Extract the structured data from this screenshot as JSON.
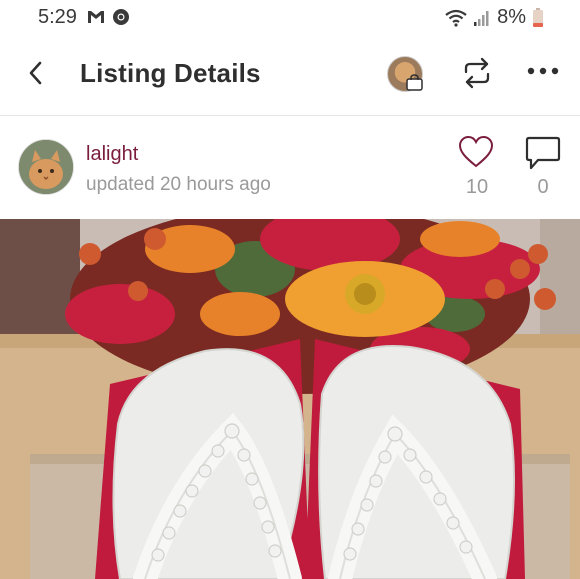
{
  "status_bar": {
    "time": "5:29",
    "battery": "8%",
    "icons": [
      "gmail-icon",
      "chrome-icon",
      "wifi-icon",
      "signal-icon",
      "battery-icon"
    ]
  },
  "header": {
    "title": "Listing Details",
    "icons": [
      "back-arrow-icon",
      "closet-avatar",
      "shopping-bag-icon",
      "share-icon",
      "more-icon"
    ]
  },
  "seller": {
    "username": "lalight",
    "updated": "updated 20 hours ago"
  },
  "stats": {
    "likes": "10",
    "comments": "0"
  },
  "listing_image": {
    "description_icon": "listing-photo"
  },
  "colors": {
    "accent": "#7b1e3e",
    "muted_text": "#9a9a9a",
    "title_text": "#2f2f2f"
  }
}
